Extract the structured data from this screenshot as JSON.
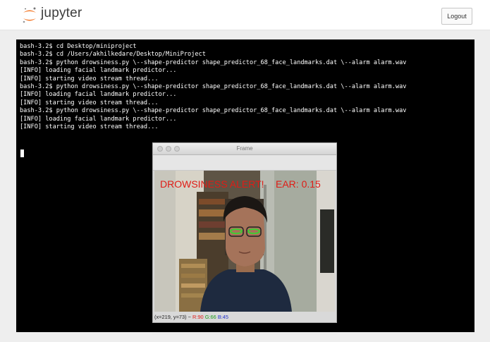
{
  "header": {
    "logo_text": "jupyter",
    "logout_label": "Logout"
  },
  "terminal": {
    "lines": [
      "bash-3.2$ cd Desktop/miniproject",
      "bash-3.2$ cd /Users/akhilkedare/Desktop/MiniProject",
      "bash-3.2$ python drowsiness.py \\--shape-predictor shape_predictor_68_face_landmarks.dat \\--alarm alarm.wav",
      "[INFO] loading facial landmark predictor...",
      "[INFO] starting video stream thread...",
      "bash-3.2$ python drowsiness.py \\--shape-predictor shape_predictor_68_face_landmarks.dat \\--alarm alarm.wav",
      "[INFO] loading facial landmark predictor...",
      "[INFO] starting video stream thread...",
      "bash-3.2$ python drowsiness.py \\--shape-predictor shape_predictor_68_face_landmarks.dat \\--alarm alarm.wav",
      "[INFO] loading facial landmark predictor...",
      "[INFO] starting video stream thread..."
    ]
  },
  "frame_window": {
    "title": "Frame",
    "alert_text": "DROWSINESS ALERT!",
    "ear_text": "EAR: 0.15",
    "status": {
      "coords": "(x=219, y=73) ~",
      "r": "R:90",
      "g": "G:66",
      "b": "B:45"
    }
  },
  "colors": {
    "alert_red": "#e01c16",
    "terminal_bg": "#000000",
    "jupyter_orange": "#f37726"
  }
}
